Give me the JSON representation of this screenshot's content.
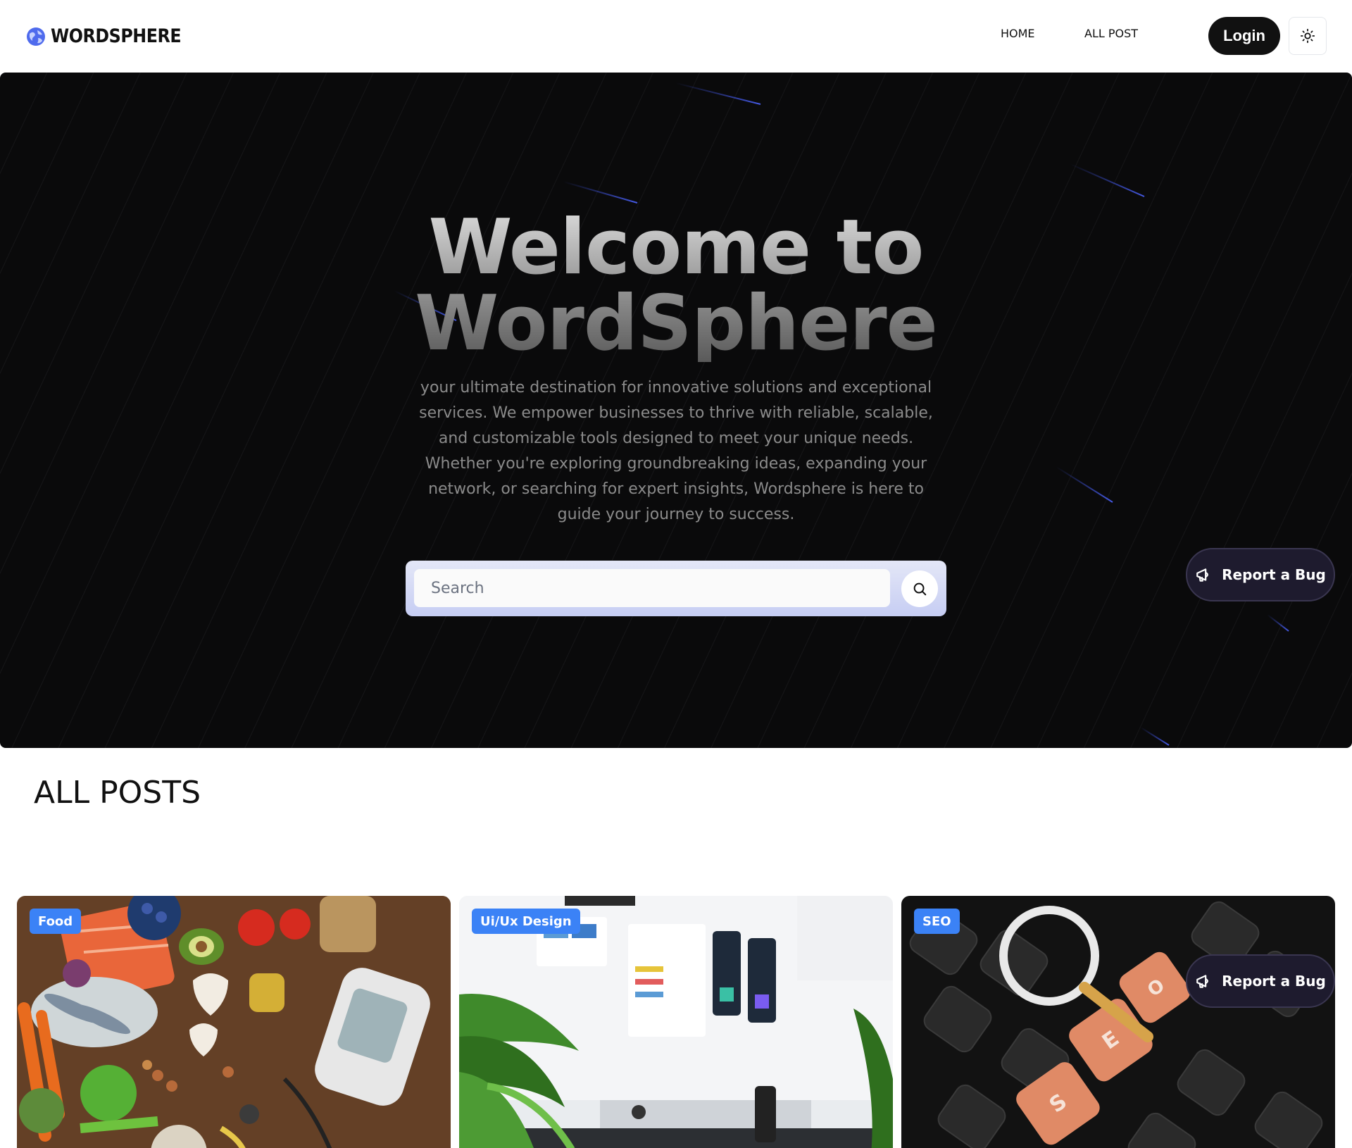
{
  "header": {
    "logo_text": "WORDSPHERE",
    "nav": {
      "home": "HOME",
      "all_post": "ALL POST"
    },
    "login_label": "Login"
  },
  "hero": {
    "title_line1": "Welcome to",
    "title_line2": "WordSphere",
    "description": "your ultimate destination for innovative solutions and exceptional services. We empower businesses to thrive with reliable, scalable, and customizable tools designed to meet your unique needs. Whether you're exploring groundbreaking ideas, expanding your network, or searching for expert insights, Wordsphere is here to guide your journey to success.",
    "search_placeholder": "Search"
  },
  "report_bug_label": "Report a Bug",
  "posts": {
    "title": "ALL POSTS",
    "cards": [
      {
        "category": "Food"
      },
      {
        "category": "Ui/Ux Design"
      },
      {
        "category": "SEO"
      }
    ]
  },
  "colors": {
    "accent": "#3b82f6",
    "hero_bg": "#0a0a0b",
    "login_bg": "#111111",
    "bug_bg": "#1e1b2e"
  },
  "icons": {
    "logo": "globe-icon",
    "theme": "sun-icon",
    "search": "search-icon",
    "bug": "megaphone-icon"
  }
}
